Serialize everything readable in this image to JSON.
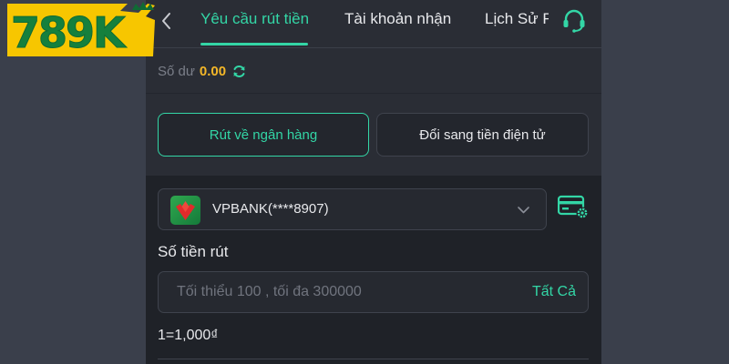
{
  "brand": {
    "logo_text": "789K",
    "colors": {
      "logo_fill": "#f7c600",
      "logo_outline": "#0f6b34",
      "logo_text": "#15803d"
    }
  },
  "header": {
    "back_icon": "chevron-left-icon",
    "tabs": [
      {
        "label": "Yêu cầu rút tiền",
        "active": true
      },
      {
        "label": "Tài khoản nhận",
        "active": false
      },
      {
        "label": "Lịch Sử R",
        "active": false
      }
    ],
    "support_icon": "headset-icon"
  },
  "balance": {
    "label": "Số dư",
    "value": "0.00",
    "refresh_icon": "refresh-icon"
  },
  "methods": [
    {
      "label": "Rút về ngân hàng",
      "selected": true
    },
    {
      "label": "Đổi sang tiền điện tử",
      "selected": false
    }
  ],
  "bank_select": {
    "bank_name": "VPBANK(****8907)",
    "bank_icon": "vpbank-logo-icon",
    "dropdown_icon": "chevron-down-icon",
    "manage_icon": "card-settings-icon"
  },
  "amount": {
    "label": "Số tiền rút",
    "value": "",
    "placeholder": "Tối thiểu 100 , tối đa 300000",
    "all_label": "Tất Cả"
  },
  "rate": "1=1,000₫",
  "colors": {
    "accent": "#33d6a6",
    "balance": "#f4b728",
    "panel_bg": "#2a2d35",
    "page_bg": "#3a3f4b"
  }
}
